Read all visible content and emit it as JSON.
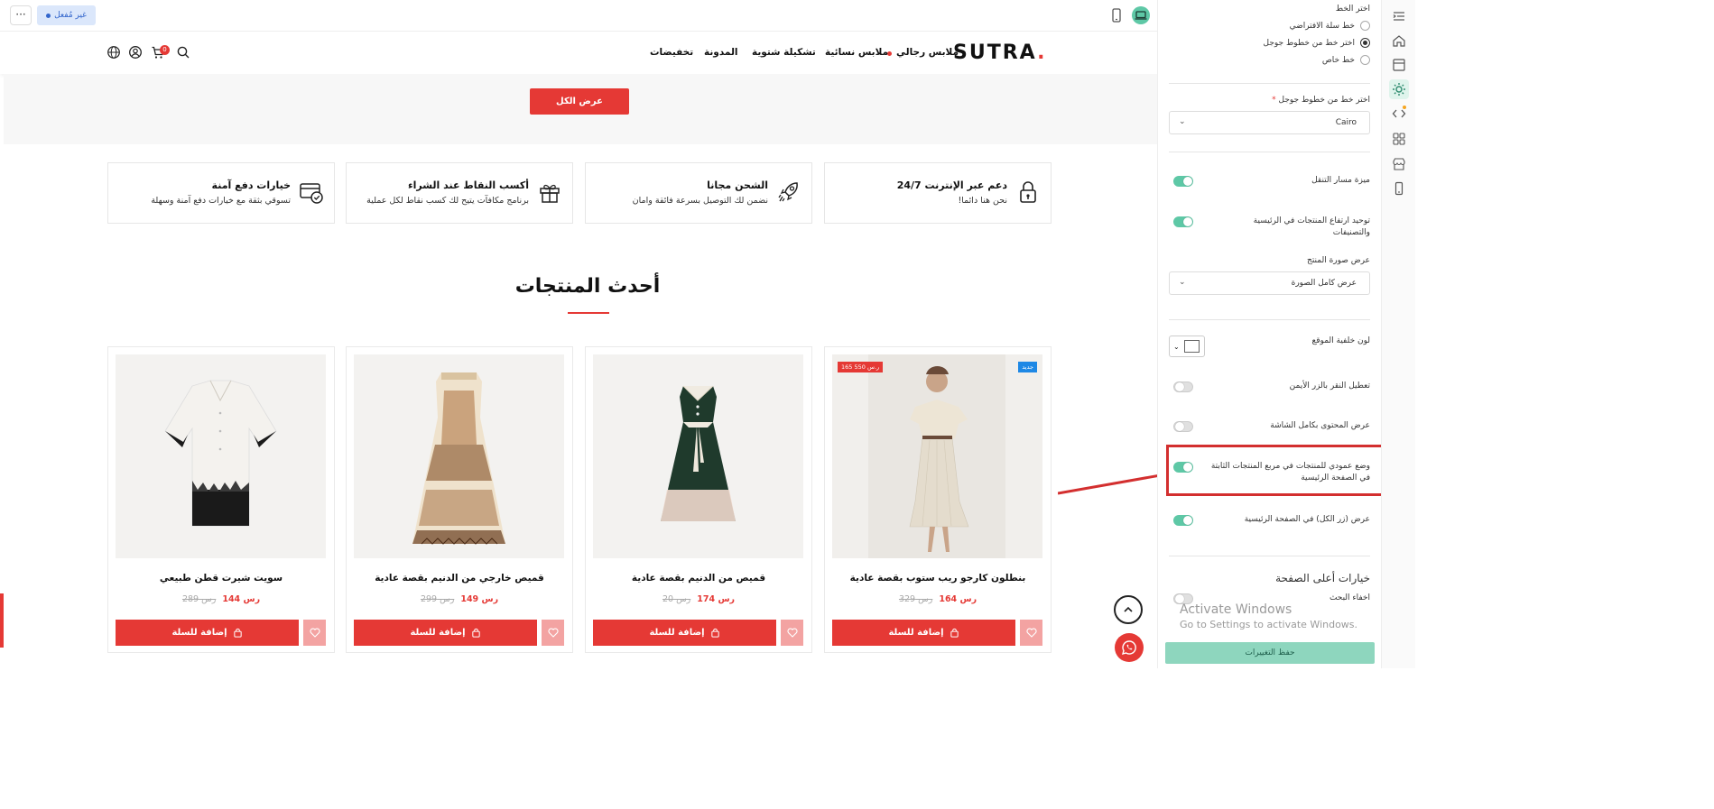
{
  "topbar": {
    "more_label": "···",
    "status_label": "غير مُفعل"
  },
  "header": {
    "logo": "SUTRA",
    "logo_dot": ".",
    "cart_count": "0",
    "nav": [
      "ملابس رجالي",
      "ملابس نسائية",
      "تشكيلة شتوية",
      "المدونة",
      "تخفيضات"
    ]
  },
  "view_all_label": "عرض الكل",
  "features": [
    {
      "title": "دعم عبر الإنترنت 24/7",
      "subtitle": "نحن هنا دائما!",
      "icon": "lock-icon"
    },
    {
      "title": "الشحن مجانا",
      "subtitle": "نضمن لك التوصيل بسرعة فائقة وامان",
      "icon": "rocket-icon"
    },
    {
      "title": "أكسب النقاط عند الشراء",
      "subtitle": "برنامج مكافآت يتيح لك كسب نقاط لكل عملية",
      "icon": "gift-icon"
    },
    {
      "title": "خيارات دفع آمنة",
      "subtitle": "تسوقي بثقة مع خيارات دفع آمنة وسهلة",
      "icon": "secure-card-icon"
    }
  ],
  "section_title": "أحدث المنتجات",
  "products": [
    {
      "name": "بنطلون كارجو ريب ستوب بقصة عادية",
      "price_new": "164",
      "price_old": "329",
      "badge_sale": "165 ر.س 550",
      "badge_new": "جديد",
      "add_label": "إضافة للسلة"
    },
    {
      "name": "قميص من الدنيم بقصة عادية",
      "price_new": "174",
      "price_old": "20",
      "add_label": "إضافة للسلة"
    },
    {
      "name": "قميص خارجي من الدنيم بقصة عادية",
      "price_new": "149",
      "price_old": "299",
      "add_label": "إضافة للسلة"
    },
    {
      "name": "سويت شيرت قطن طبيعي",
      "price_new": "144",
      "price_old": "289",
      "add_label": "إضافة للسلة"
    }
  ],
  "panel": {
    "font_label": "اختر الخط",
    "font_options": [
      "خط سلة الافتراضي",
      "اختر خط من خطوط جوجل",
      "خط خاص"
    ],
    "google_font_label": "اختر خط من خطوط جوجل",
    "required_mark": "*",
    "google_font_value": "Cairo",
    "breadcrumb_label": "ميزة مسار التنقل",
    "unify_height_label": "توحيد ارتفاع المنتجات في الرئيسية والتصنيفات",
    "image_display_label": "عرض صورة المنتج",
    "image_display_value": "عرض كامل الصورة",
    "bg_color_label": "لون خلفية الموقع",
    "disable_right_click_label": "تعطيل النقر بالزر الأيمن",
    "full_width_label": "عرض المحتوى بكامل الشاشة",
    "vertical_mode_label": "وضع عمودي للمنتجات في مربع المنتجات الثابتة في الصفحة الرئيسية",
    "show_all_btn_label": "عرض (زر الكل) في الصفحة الرئيسية",
    "top_options_heading": "خيارات أعلى الصفحة",
    "hide_search_label": "اخفاء البحث",
    "save_label": "حفظ التغييرات",
    "watermark_l1": "Activate Windows",
    "watermark_l2": "Go to Settings to activate Windows."
  },
  "colors": {
    "accent": "#e53935",
    "toggle_on": "#5ec8a6",
    "highlight": "#d32f2f"
  }
}
